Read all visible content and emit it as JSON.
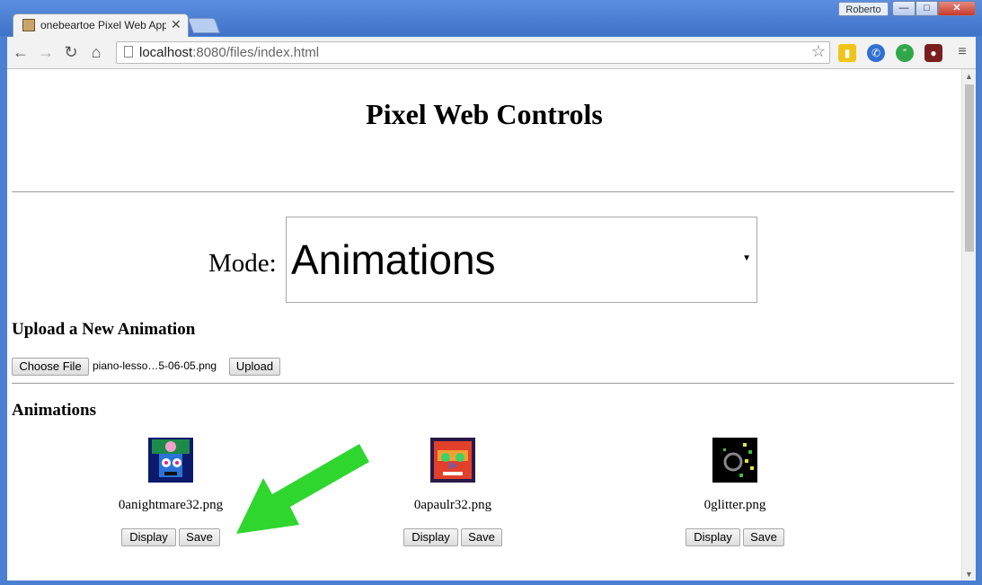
{
  "window": {
    "tab_title": "onebeartoe Pixel Web App",
    "user": "Roberto",
    "minimize": "—",
    "maximize": "□",
    "close": "✕"
  },
  "toolbar": {
    "url_host": "localhost",
    "url_rest": ":8080/files/index.html",
    "icons": [
      "back-icon",
      "forward-icon",
      "reload-icon",
      "home-icon",
      "star-icon",
      "menu-icon"
    ]
  },
  "page": {
    "title": "Pixel Web Controls",
    "mode_label": "Mode:",
    "mode_value": "Animations",
    "upload_heading": "Upload a New Animation",
    "choose_file_label": "Choose File",
    "selected_file": "piano-lesso…5-06-05.png",
    "upload_label": "Upload",
    "animations_heading": "Animations",
    "animations": [
      {
        "name": "0anightmare32.png",
        "display_label": "Display",
        "save_label": "Save"
      },
      {
        "name": "0apaulr32.png",
        "display_label": "Display",
        "save_label": "Save"
      },
      {
        "name": "0glitter.png",
        "display_label": "Display",
        "save_label": "Save"
      }
    ]
  },
  "colors": {
    "annotation_arrow": "#2ed62e",
    "chrome_blue": "#4a7fd2",
    "close_red": "#c7392a"
  }
}
